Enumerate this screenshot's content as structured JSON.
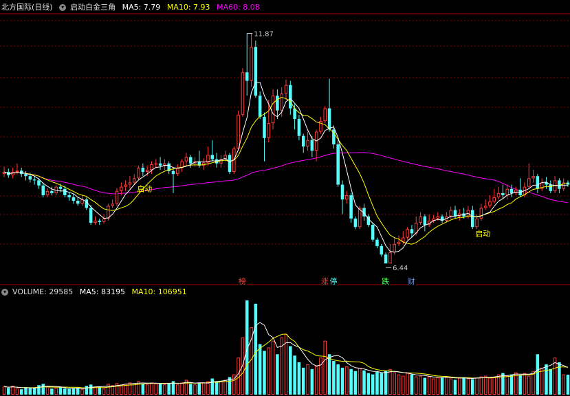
{
  "header": {
    "title": "北方国际(日线)",
    "indicator": "启动白金三角",
    "ma5_label": "MA5: 7.79",
    "ma10_label": "MA10: 7.93",
    "ma60_label": "MA60: 8.08"
  },
  "volume_header": {
    "title": "VOLUME: 29585",
    "ma5_label": "MA5: 83195",
    "ma10_label": "MA10: 106951"
  },
  "colors": {
    "up": "#ff3c3c",
    "down": "#54fcfc",
    "ma5": "#ffffff",
    "ma10": "#ffff00",
    "ma60": "#ff00ff",
    "grid": "#8b0000",
    "label": "#ffff00"
  },
  "chart_data": [
    {
      "type": "candlestick",
      "price_range": [
        6.2,
        12.3
      ],
      "highlighted_prices": {
        "max": "11.87",
        "min": "6.44"
      },
      "signals": [
        {
          "text": "启动",
          "index": 30
        },
        {
          "text": "启动",
          "index": 108
        }
      ],
      "event_tags": [
        {
          "text": "榜",
          "index": 55,
          "color": "#ff3c3c"
        },
        {
          "text": "涨",
          "index": 74,
          "color": "#ff3c3c"
        },
        {
          "text": "停",
          "index": 76,
          "color": "#54fcfc"
        },
        {
          "text": "跌",
          "index": 88,
          "color": "#54fc54"
        },
        {
          "text": "财",
          "index": 94,
          "color": "#5c8cff"
        }
      ],
      "candles": [
        [
          8.55,
          8.6,
          8.72,
          8.48
        ],
        [
          8.6,
          8.52,
          8.68,
          8.46
        ],
        [
          8.52,
          8.6,
          8.7,
          8.45
        ],
        [
          8.6,
          8.63,
          8.8,
          8.55
        ],
        [
          8.63,
          8.55,
          8.7,
          8.48
        ],
        [
          8.55,
          8.5,
          8.62,
          8.4
        ],
        [
          8.5,
          8.42,
          8.58,
          8.35
        ],
        [
          8.42,
          8.4,
          8.5,
          8.3
        ],
        [
          8.4,
          8.28,
          8.45,
          8.2
        ],
        [
          8.28,
          8.05,
          8.35,
          8.0
        ],
        [
          8.05,
          8.15,
          8.22,
          8.0
        ],
        [
          8.15,
          8.1,
          8.25,
          8.05
        ],
        [
          8.1,
          8.25,
          8.3,
          8.05
        ],
        [
          8.25,
          8.2,
          8.32,
          8.12
        ],
        [
          8.2,
          8.05,
          8.28,
          8.0
        ],
        [
          8.05,
          8.0,
          8.12,
          7.92
        ],
        [
          8.0,
          7.92,
          8.08,
          7.85
        ],
        [
          7.92,
          7.85,
          8.0,
          7.8
        ],
        [
          7.85,
          7.95,
          8.05,
          7.8
        ],
        [
          7.95,
          7.75,
          8.0,
          7.7
        ],
        [
          7.75,
          7.4,
          7.82,
          7.35
        ],
        [
          7.4,
          7.45,
          7.55,
          7.35
        ],
        [
          7.45,
          7.42,
          7.5,
          7.35
        ],
        [
          7.42,
          7.5,
          7.6,
          7.38
        ],
        [
          7.5,
          7.8,
          7.85,
          7.45
        ],
        [
          7.8,
          7.85,
          7.95,
          7.75
        ],
        [
          7.85,
          8.15,
          8.22,
          7.8
        ],
        [
          8.15,
          8.25,
          8.35,
          8.05
        ],
        [
          8.25,
          8.3,
          8.4,
          8.15
        ],
        [
          8.3,
          8.35,
          8.5,
          8.2
        ],
        [
          8.35,
          8.45,
          8.55,
          8.3
        ],
        [
          8.45,
          8.7,
          8.75,
          8.4
        ],
        [
          8.7,
          8.6,
          8.8,
          8.5
        ],
        [
          8.6,
          8.65,
          8.75,
          8.5
        ],
        [
          8.65,
          8.78,
          8.85,
          8.55
        ],
        [
          8.78,
          8.8,
          8.9,
          8.7
        ],
        [
          8.8,
          8.75,
          8.95,
          8.65
        ],
        [
          8.75,
          8.8,
          8.9,
          8.65
        ],
        [
          8.8,
          8.62,
          8.85,
          8.55
        ],
        [
          8.62,
          8.55,
          8.7,
          8.1
        ],
        [
          8.55,
          8.7,
          8.78,
          8.5
        ],
        [
          8.7,
          8.85,
          8.9,
          8.6
        ],
        [
          8.85,
          8.95,
          9.05,
          8.75
        ],
        [
          8.95,
          8.8,
          9.0,
          8.7
        ],
        [
          8.8,
          8.85,
          8.95,
          8.72
        ],
        [
          8.85,
          8.75,
          9.1,
          8.7
        ],
        [
          8.75,
          8.82,
          8.92,
          8.65
        ],
        [
          8.82,
          9.0,
          9.2,
          8.75
        ],
        [
          9.0,
          8.9,
          9.35,
          8.85
        ],
        [
          8.9,
          8.8,
          9.05,
          8.7
        ],
        [
          8.8,
          8.9,
          9.0,
          8.7
        ],
        [
          8.9,
          9.0,
          9.1,
          8.85
        ],
        [
          9.0,
          8.6,
          9.05,
          8.55
        ],
        [
          8.6,
          9.15,
          9.2,
          8.55
        ],
        [
          9.15,
          9.95,
          10.05,
          9.1
        ],
        [
          9.95,
          10.95,
          11.05,
          9.9
        ],
        [
          10.95,
          10.75,
          11.87,
          10.4
        ],
        [
          10.75,
          11.55,
          11.87,
          10.6
        ],
        [
          11.55,
          10.4,
          11.7,
          10.35
        ],
        [
          10.4,
          9.9,
          10.5,
          9.85
        ],
        [
          9.9,
          9.4,
          10.0,
          8.85
        ],
        [
          9.4,
          9.75,
          10.3,
          9.3
        ],
        [
          9.75,
          10.4,
          10.55,
          9.6
        ],
        [
          10.4,
          10.05,
          10.55,
          9.85
        ],
        [
          10.05,
          10.45,
          10.6,
          9.9
        ],
        [
          10.45,
          10.65,
          10.78,
          10.3
        ],
        [
          10.65,
          10.1,
          10.75,
          9.95
        ],
        [
          10.1,
          9.85,
          10.2,
          9.6
        ],
        [
          9.85,
          9.45,
          9.95,
          9.35
        ],
        [
          9.45,
          9.2,
          9.5,
          9.05
        ],
        [
          9.2,
          9.35,
          9.55,
          9.1
        ],
        [
          9.35,
          9.1,
          9.45,
          8.95
        ],
        [
          9.1,
          9.55,
          9.6,
          8.85
        ],
        [
          9.55,
          9.8,
          9.9,
          9.5
        ],
        [
          9.8,
          10.1,
          10.15,
          9.75
        ],
        [
          10.1,
          9.6,
          10.8,
          9.55
        ],
        [
          9.6,
          9.25,
          9.7,
          9.15
        ],
        [
          9.25,
          8.3,
          9.35,
          8.25
        ],
        [
          8.3,
          7.95,
          8.4,
          7.6
        ],
        [
          7.95,
          8.05,
          8.15,
          7.85
        ],
        [
          8.05,
          7.5,
          8.1,
          7.4
        ],
        [
          7.5,
          7.3,
          7.55,
          7.25
        ],
        [
          7.3,
          7.75,
          7.8,
          7.25
        ],
        [
          7.75,
          7.55,
          7.85,
          7.45
        ],
        [
          7.55,
          7.35,
          7.6,
          7.3
        ],
        [
          7.35,
          7.0,
          7.4,
          6.95
        ],
        [
          7.0,
          6.85,
          7.05,
          6.8
        ],
        [
          6.85,
          6.65,
          6.9,
          6.6
        ],
        [
          6.65,
          6.44,
          6.7,
          6.44
        ],
        [
          6.44,
          6.7,
          6.9,
          6.44
        ],
        [
          6.7,
          6.9,
          7.05,
          6.65
        ],
        [
          6.9,
          6.95,
          7.1,
          6.85
        ],
        [
          6.95,
          7.05,
          7.2,
          6.9
        ],
        [
          7.05,
          7.25,
          7.3,
          7.0
        ],
        [
          7.25,
          7.15,
          7.35,
          7.05
        ],
        [
          7.15,
          7.4,
          7.55,
          7.1
        ],
        [
          7.4,
          7.55,
          7.65,
          7.35
        ],
        [
          7.55,
          7.35,
          7.6,
          7.2
        ],
        [
          7.35,
          7.45,
          7.6,
          7.3
        ],
        [
          7.45,
          7.5,
          7.58,
          7.4
        ],
        [
          7.5,
          7.55,
          7.65,
          7.45
        ],
        [
          7.55,
          7.45,
          7.6,
          7.4
        ],
        [
          7.45,
          7.55,
          7.65,
          7.4
        ],
        [
          7.55,
          7.7,
          7.78,
          7.5
        ],
        [
          7.7,
          7.55,
          7.8,
          7.5
        ],
        [
          7.55,
          7.62,
          7.72,
          7.45
        ],
        [
          7.62,
          7.55,
          7.75,
          7.5
        ],
        [
          7.55,
          7.7,
          7.8,
          7.5
        ],
        [
          7.7,
          7.3,
          7.8,
          7.25
        ],
        [
          7.3,
          7.5,
          7.6,
          7.25
        ],
        [
          7.5,
          7.75,
          7.85,
          7.45
        ],
        [
          7.75,
          7.8,
          7.95,
          7.7
        ],
        [
          7.8,
          7.9,
          8.05,
          7.75
        ],
        [
          7.9,
          8.0,
          8.2,
          7.85
        ],
        [
          8.0,
          8.1,
          8.25,
          7.95
        ],
        [
          8.1,
          8.05,
          8.3,
          7.95
        ],
        [
          8.05,
          8.2,
          8.3,
          7.95
        ],
        [
          8.2,
          8.1,
          8.3,
          8.0
        ],
        [
          8.1,
          8.18,
          8.25,
          8.05
        ],
        [
          8.18,
          8.05,
          8.45,
          8.0
        ],
        [
          8.05,
          8.25,
          8.35,
          8.0
        ],
        [
          8.25,
          8.45,
          8.8,
          8.2
        ],
        [
          8.45,
          8.5,
          8.65,
          8.35
        ],
        [
          8.5,
          8.2,
          8.55,
          8.1
        ],
        [
          8.2,
          8.35,
          8.45,
          8.15
        ],
        [
          8.35,
          8.3,
          8.48,
          8.2
        ],
        [
          8.3,
          8.15,
          8.4,
          8.1
        ],
        [
          8.15,
          8.4,
          8.5,
          8.1
        ],
        [
          8.4,
          8.2,
          8.45,
          8.1
        ],
        [
          8.2,
          8.35,
          8.45,
          8.15
        ],
        [
          8.35,
          8.3,
          8.4,
          8.25
        ]
      ]
    },
    {
      "type": "bar",
      "volume_range": [
        0,
        145000
      ],
      "volumes": [
        12000,
        10000,
        13000,
        9000,
        8000,
        11000,
        9500,
        10500,
        14000,
        16000,
        12000,
        9000,
        10000,
        11000,
        9000,
        8500,
        9000,
        10000,
        8000,
        13000,
        15000,
        11000,
        12000,
        9000,
        16000,
        14000,
        17000,
        15000,
        16000,
        18000,
        17000,
        20000,
        16000,
        15000,
        18000,
        17000,
        16000,
        15000,
        17000,
        20000,
        15000,
        18000,
        22000,
        16000,
        15000,
        17000,
        18000,
        20000,
        24000,
        19000,
        20000,
        22000,
        26000,
        30000,
        55000,
        85000,
        140000,
        100000,
        135000,
        75000,
        65000,
        70000,
        80000,
        60000,
        85000,
        90000,
        72000,
        58000,
        48000,
        40000,
        45000,
        38000,
        42000,
        55000,
        80000,
        60000,
        50000,
        45000,
        40000,
        42000,
        38000,
        35000,
        40000,
        36000,
        32000,
        30000,
        34000,
        32000,
        35000,
        38000,
        33000,
        30000,
        28000,
        32000,
        30000,
        27000,
        28000,
        25000,
        27000,
        24000,
        26000,
        25000,
        27000,
        24000,
        22000,
        25000,
        26000,
        24000,
        23000,
        25000,
        27000,
        28000,
        25000,
        26000,
        30000,
        32000,
        28000,
        30000,
        33000,
        29000,
        32000,
        28000,
        35000,
        60000,
        40000,
        45000,
        38000,
        55000,
        48000,
        30000,
        29585
      ]
    }
  ]
}
